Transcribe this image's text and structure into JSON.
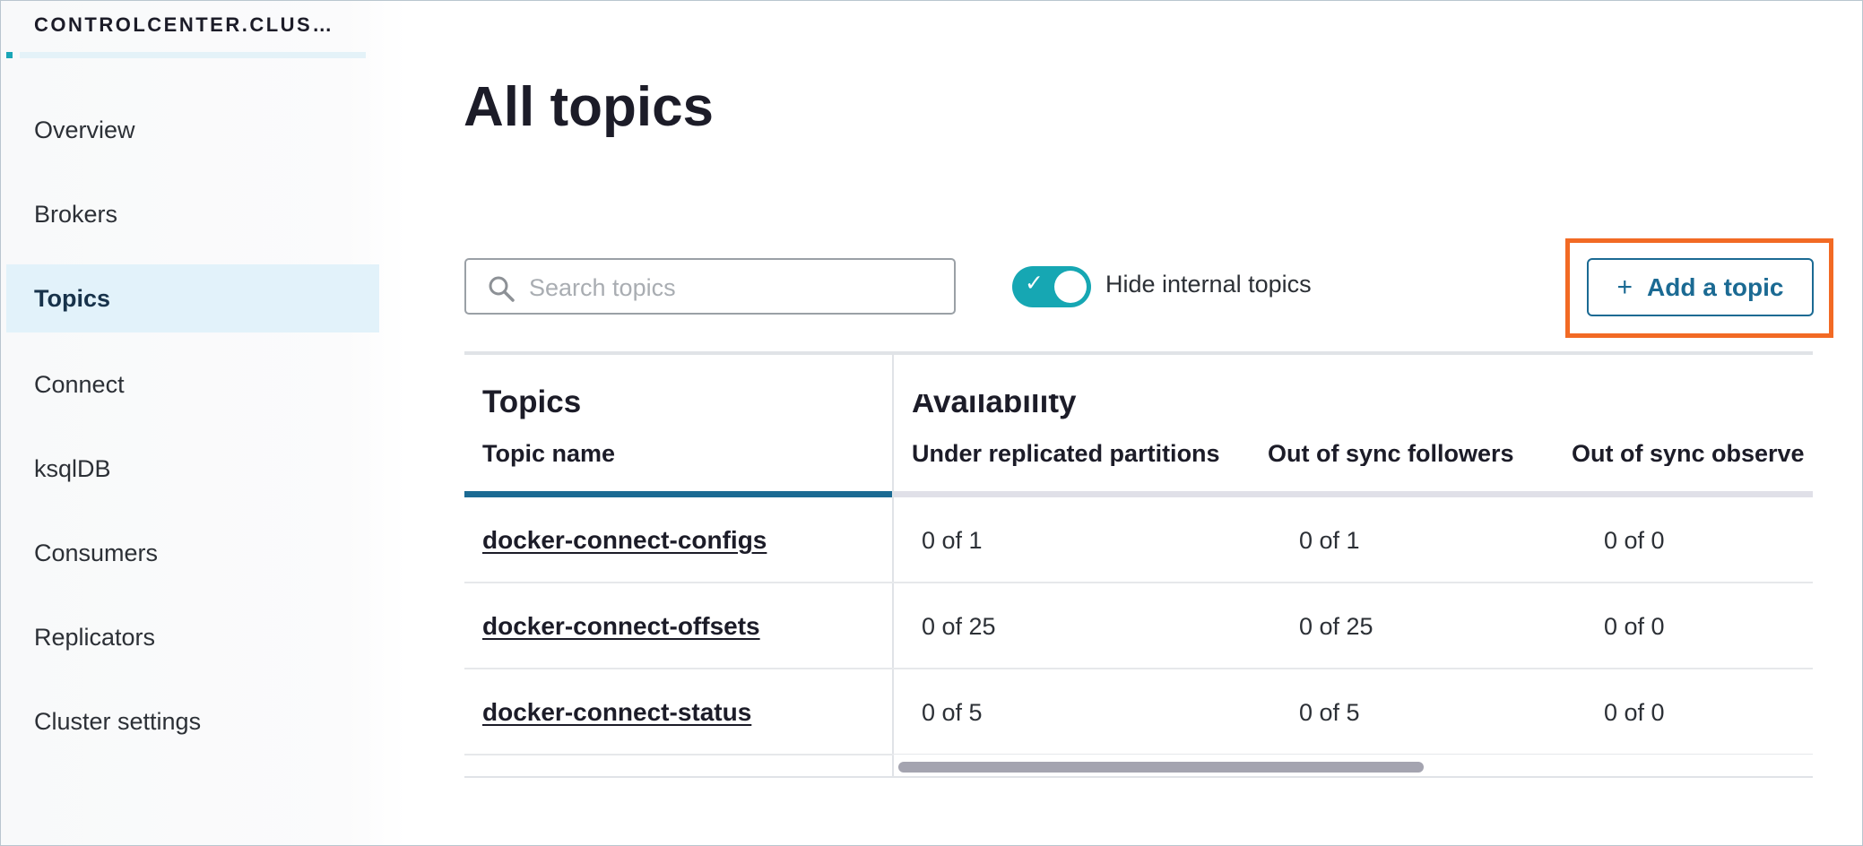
{
  "sidebar": {
    "cluster_name": "CONTROLCENTER.CLUS…",
    "items": [
      {
        "label": "Overview",
        "active": false
      },
      {
        "label": "Brokers",
        "active": false
      },
      {
        "label": "Topics",
        "active": true
      },
      {
        "label": "Connect",
        "active": false
      },
      {
        "label": "ksqlDB",
        "active": false
      },
      {
        "label": "Consumers",
        "active": false
      },
      {
        "label": "Replicators",
        "active": false
      },
      {
        "label": "Cluster settings",
        "active": false
      }
    ]
  },
  "main": {
    "title": "All topics",
    "search": {
      "placeholder": "Search topics",
      "value": "",
      "icon": "search-icon"
    },
    "toggle": {
      "label": "Hide internal topics",
      "on": true,
      "icon": "check-icon"
    },
    "add_button": {
      "icon": "+",
      "label": "Add a topic"
    }
  },
  "table": {
    "groups": [
      "Topics",
      "Availability"
    ],
    "columns": [
      "Topic name",
      "Under replicated partitions",
      "Out of sync followers",
      "Out of sync observe"
    ],
    "rows": [
      {
        "name": "docker-connect-configs",
        "under_replicated": "0 of 1",
        "out_of_sync_followers": "0 of 1",
        "out_of_sync_observers": "0 of 0"
      },
      {
        "name": "docker-connect-offsets",
        "under_replicated": "0 of 25",
        "out_of_sync_followers": "0 of 25",
        "out_of_sync_observers": "0 of 0"
      },
      {
        "name": "docker-connect-status",
        "under_replicated": "0 of 5",
        "out_of_sync_followers": "0 of 5",
        "out_of_sync_observers": "0 of 0"
      }
    ]
  },
  "colors": {
    "accent": "#16a7b3",
    "button": "#1b6a93",
    "highlight": "#f26a24",
    "active_nav_bg": "#e2f2fa"
  }
}
